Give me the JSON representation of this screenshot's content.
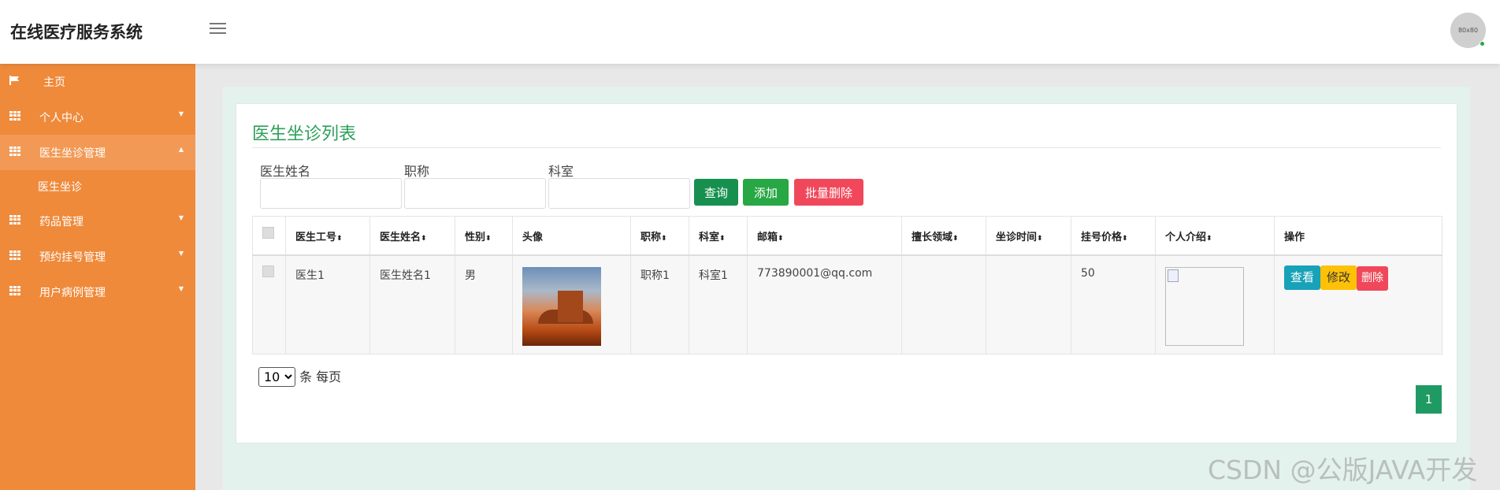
{
  "app": {
    "title": "在线医疗服务系统",
    "avatar_text": "80x80"
  },
  "sidebar": {
    "items": [
      {
        "label": "主页",
        "icon": "flag-icon"
      },
      {
        "label": "个人中心",
        "icon": "grid-icon"
      },
      {
        "label": "医生坐诊管理",
        "icon": "grid-icon",
        "expanded": true
      },
      {
        "label": "医生坐诊",
        "icon": ""
      },
      {
        "label": "药品管理",
        "icon": "grid-icon"
      },
      {
        "label": "预约挂号管理",
        "icon": "grid-icon"
      },
      {
        "label": "用户病例管理",
        "icon": "grid-icon"
      }
    ]
  },
  "page": {
    "title": "医生坐诊列表"
  },
  "filters": {
    "name_label": "医生姓名",
    "name_value": "",
    "title_label": "职称",
    "title_value": "",
    "dept_label": "科室",
    "dept_value": ""
  },
  "buttons": {
    "query": "查询",
    "add": "添加",
    "batch_delete": "批量删除"
  },
  "table": {
    "headers": [
      "医生工号",
      "医生姓名",
      "性别",
      "头像",
      "职称",
      "科室",
      "邮箱",
      "擅长领域",
      "坐诊时间",
      "挂号价格",
      "个人介绍",
      "操作"
    ],
    "rows": [
      {
        "id": "医生1",
        "name": "医生姓名1",
        "gender": "男",
        "title": "职称1",
        "dept": "科室1",
        "email": "773890001@qq.com",
        "specialty": "",
        "time": "",
        "price": "50"
      }
    ],
    "actions": {
      "view": "查看",
      "edit": "修改",
      "delete": "删除"
    }
  },
  "pagination": {
    "page_size": "10",
    "suffix": "条 每页",
    "current_page": "1"
  },
  "watermark": "CSDN @公版JAVA开发",
  "colors": {
    "sidebar": "#ef8a3b",
    "title": "#2ea05a",
    "query": "#17904f",
    "add": "#28a745",
    "danger": "#f0485a",
    "info": "#17a2b8",
    "warning": "#ffc107"
  }
}
